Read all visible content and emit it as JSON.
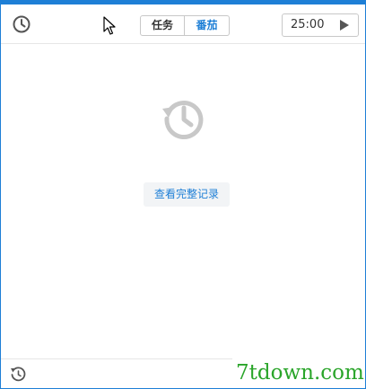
{
  "toolbar": {
    "segments": [
      "任务",
      "番茄"
    ],
    "active_segment": "番茄",
    "timer": "25:00"
  },
  "main": {
    "view_history_label": "查看完整记录"
  },
  "watermark": "7tdown.com",
  "icons": {
    "clock": "clock-icon",
    "play": "play-icon",
    "history": "history-icon",
    "sync": "sync-history-icon",
    "cursor": "mouse-cursor"
  },
  "colors": {
    "accent": "#1e7fd6",
    "icon_gray": "#c8c8c8",
    "watermark": "#2aa52a"
  }
}
